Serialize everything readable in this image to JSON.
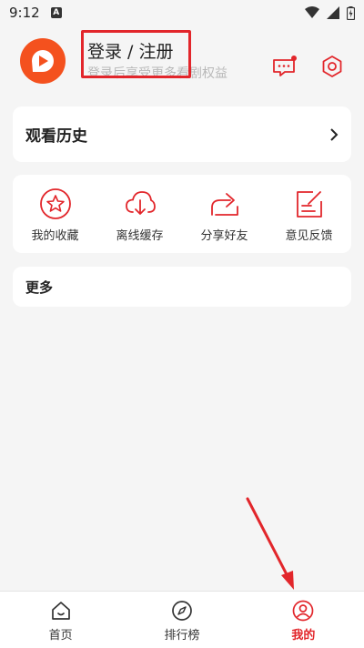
{
  "status_bar": {
    "time": "9:12",
    "a_icon": "A"
  },
  "profile": {
    "login_title": "登录 / 注册",
    "login_subtitle": "登录后享受更多看剧权益",
    "message_has_badge": true
  },
  "history": {
    "label": "观看历史"
  },
  "quick_actions": [
    {
      "label": "我的收藏",
      "icon": "star-icon"
    },
    {
      "label": "离线缓存",
      "icon": "download-cloud-icon"
    },
    {
      "label": "分享好友",
      "icon": "share-icon"
    },
    {
      "label": "意见反馈",
      "icon": "feedback-edit-icon"
    }
  ],
  "more": {
    "label": "更多"
  },
  "bottom_nav": [
    {
      "label": "首页",
      "icon": "home-icon",
      "active": false
    },
    {
      "label": "排行榜",
      "icon": "compass-icon",
      "active": false
    },
    {
      "label": "我的",
      "icon": "user-icon",
      "active": true
    }
  ],
  "colors": {
    "accent": "#e2262b",
    "logo_orange": "#f4511e",
    "background": "#f5f5f5"
  }
}
